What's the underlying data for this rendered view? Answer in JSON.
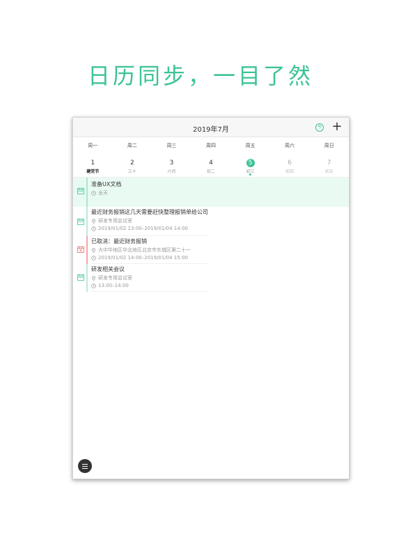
{
  "headline": "日历同步，一目了然",
  "header": {
    "month_title": "2019年7月",
    "today_label": "今",
    "add_label": "+"
  },
  "weekdays": [
    "周一",
    "周二",
    "周三",
    "周四",
    "周五",
    "周六",
    "周日"
  ],
  "dates": [
    {
      "num": "1",
      "sub": "建党节"
    },
    {
      "num": "2",
      "sub": "三十"
    },
    {
      "num": "3",
      "sub": "六月"
    },
    {
      "num": "4",
      "sub": "初二"
    },
    {
      "num": "5",
      "sub": "初三"
    },
    {
      "num": "6",
      "sub": "初四"
    },
    {
      "num": "7",
      "sub": "初五"
    }
  ],
  "selected_date": "5",
  "events": [
    {
      "title": "准备UX文档",
      "time": "全天",
      "status": "all-day"
    },
    {
      "title": "最近财务报销这几天需要赶快整理报销单给公司",
      "location": "研发专用会议室",
      "time": "2019/01/02  13:00–2019/01/04  14:00",
      "status": "normal"
    },
    {
      "title": "已取消：最近财务报销",
      "location": "大中华地区华北地区北京市东城区第二十一",
      "time": "2019/01/02  14:00–2019/01/04  15:00",
      "status": "cancelled"
    },
    {
      "title": "研发相关会议",
      "location": "研发专用会议室",
      "time": "13:00–14:00",
      "status": "normal"
    }
  ],
  "colors": {
    "accent": "#3cc394",
    "cancel": "#e76a6a",
    "allday_bg": "#e9faf3"
  },
  "icons": {
    "event": "calendar-icon",
    "cancelled": "calendar-cancel-icon",
    "clock": "clock-icon",
    "location": "location-pin-icon",
    "menu": "hamburger-menu-icon"
  }
}
